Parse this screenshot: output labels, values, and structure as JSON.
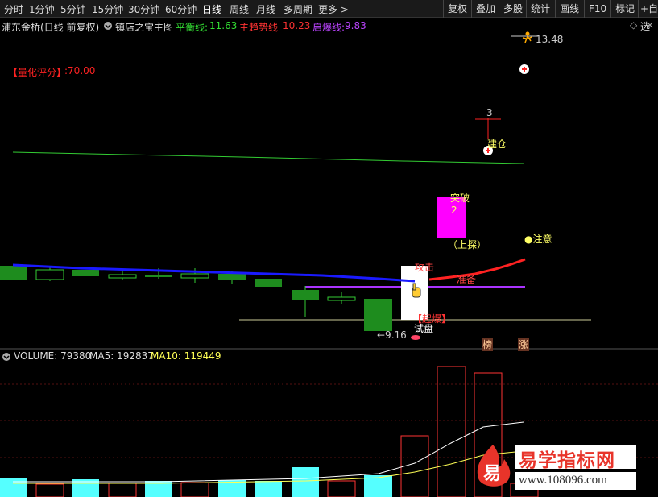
{
  "topbar": {
    "periods": [
      "分时",
      "1分钟",
      "5分钟",
      "15分钟",
      "30分钟",
      "60分钟",
      "日线",
      "周线",
      "月线",
      "多周期",
      "更多"
    ],
    "more_arrow": ">",
    "tools": [
      "复权",
      "叠加",
      "多股",
      "统计",
      "画线",
      "F10",
      "标记",
      "+自选"
    ]
  },
  "info": {
    "stock_name": "浦东金桥(日线 前复权)",
    "indicator_name": "镇店之宝主图",
    "balance_label": "平衡线:",
    "balance_value": "11.63",
    "trend_label": "主趋势线",
    "trend_value": "10.23",
    "burst_label": "启爆线:",
    "burst_value": "9.83"
  },
  "score": {
    "label": "【量化评分】",
    "value": ":70.00"
  },
  "annotations": {
    "top_value": "13.48",
    "count": "3",
    "build": "建仓",
    "breakthrough": "突破",
    "breakthrough_num": "2",
    "probe": "（上探）",
    "attention": "●注意",
    "attack": "攻击",
    "prepare": "准备",
    "start": "【起爆】",
    "low_value": "←9.16",
    "trial": "试盘",
    "badge_list": "榜",
    "badge_rise": "涨"
  },
  "volume": {
    "label": "VOLUME: 79380",
    "ma5_label": "MA5: 192837",
    "ma10_label": "MA10: 119449"
  },
  "watermark": {
    "logo_char": "易",
    "title": "易学指标网",
    "url": "www.108096.com"
  },
  "colors": {
    "balance": "#33cc33",
    "trend": "#ff2222",
    "burst": "#aa33ff",
    "ma_blue": "#1a1aff",
    "volume_up": "#55ffff",
    "volume_down": "#ff3333"
  }
}
